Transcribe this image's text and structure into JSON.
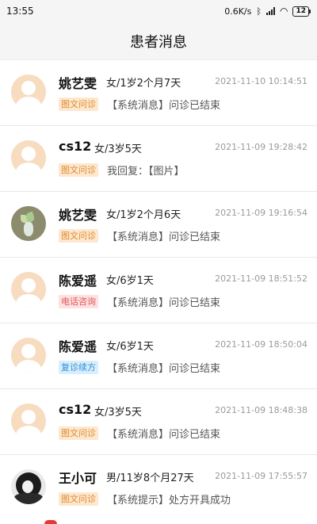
{
  "status_bar": {
    "time": "13:55",
    "speed": "0.6K/s",
    "battery": "12",
    "icons": [
      "bluetooth-icon",
      "signal-icon",
      "wifi-icon",
      "battery-icon"
    ]
  },
  "header": {
    "title": "患者消息"
  },
  "colors": {
    "tag_orange_bg": "#fde8cf",
    "tag_orange_text": "#e08a2e",
    "tag_red_bg": "#fde0e0",
    "tag_red_text": "#e25858",
    "tag_blue_bg": "#d8eefc",
    "tag_blue_text": "#2f8fd8",
    "avatar_placeholder": "#f7dcc0"
  },
  "messages": [
    {
      "name": "姚艺雯",
      "info": "女/1岁2个月7天",
      "time": "2021-11-10 10:14:51",
      "tag": "图文问诊",
      "tag_color": "orange",
      "text": "【系统消息】问诊已结束",
      "avatar": "placeholder"
    },
    {
      "name": "cs12",
      "info": "女/3岁5天",
      "time": "2021-11-09 19:28:42",
      "tag": "图文问诊",
      "tag_color": "orange",
      "text": "我回复：【图片】",
      "avatar": "placeholder"
    },
    {
      "name": "姚艺雯",
      "info": "女/1岁2个月6天",
      "time": "2021-11-09 19:16:54",
      "tag": "图文问诊",
      "tag_color": "orange",
      "text": "【系统消息】问诊已结束",
      "avatar": "plant-photo"
    },
    {
      "name": "陈爱遥",
      "info": "女/6岁1天",
      "time": "2021-11-09 18:51:52",
      "tag": "电话咨询",
      "tag_color": "red",
      "text": "【系统消息】问诊已结束",
      "avatar": "placeholder"
    },
    {
      "name": "陈爱遥",
      "info": "女/6岁1天",
      "time": "2021-11-09 18:50:04",
      "tag": "复诊续方",
      "tag_color": "blue",
      "text": "【系统消息】问诊已结束",
      "avatar": "placeholder"
    },
    {
      "name": "cs12",
      "info": "女/3岁5天",
      "time": "2021-11-09 18:48:38",
      "tag": "图文问诊",
      "tag_color": "orange",
      "text": "【系统消息】问诊已结束",
      "avatar": "placeholder"
    },
    {
      "name": "王小可",
      "info": "男/11岁8个月27天",
      "time": "2021-11-09 17:55:57",
      "tag": "图文问诊",
      "tag_color": "orange",
      "text": "【系统提示】处方开具成功",
      "avatar": "bw-photo"
    }
  ]
}
